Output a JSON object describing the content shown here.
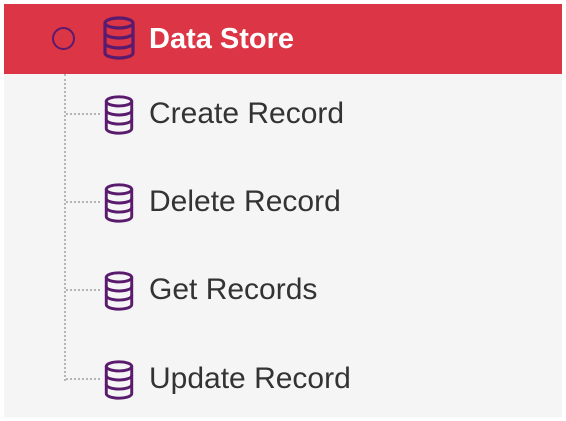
{
  "colors": {
    "root_background": "#dc3545",
    "root_text": "#ffffff",
    "icon_stroke": "#5a1a6e",
    "child_text": "#333333",
    "panel_background": "#f5f5f5"
  },
  "tree": {
    "root": {
      "label": "Data Store",
      "icon": "database-icon",
      "expander": "circle-expander",
      "state": "selected, expanded"
    },
    "children": [
      {
        "label": "Create Record",
        "icon": "database-icon"
      },
      {
        "label": "Delete Record",
        "icon": "database-icon"
      },
      {
        "label": "Get Records",
        "icon": "database-icon"
      },
      {
        "label": "Update Record",
        "icon": "database-icon"
      }
    ]
  }
}
